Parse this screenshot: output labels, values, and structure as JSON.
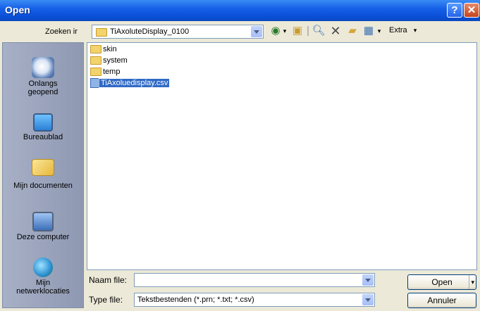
{
  "window": {
    "title": "Open"
  },
  "lookin": {
    "label": "Zoeken ir",
    "value": "TiAxoluteDisplay_0100"
  },
  "toolbar": {
    "extra_label": "Extra"
  },
  "places": [
    {
      "label": "Onlangs geopend"
    },
    {
      "label": "Bureaublad"
    },
    {
      "label": "Mijn documenten"
    },
    {
      "label": "Deze computer"
    },
    {
      "label": "Mijn netwerklocaties"
    }
  ],
  "files": [
    {
      "name": "skin",
      "type": "folder"
    },
    {
      "name": "system",
      "type": "folder"
    },
    {
      "name": "temp",
      "type": "folder"
    },
    {
      "name": "TiAxoluedisplay.csv",
      "type": "csv",
      "selected": true
    }
  ],
  "filename": {
    "label": "Naam file:",
    "value": ""
  },
  "filetype": {
    "label": "Type file:",
    "value": "Tekstbestenden (*.prn; *.txt; *.csv)"
  },
  "buttons": {
    "open": "Open",
    "cancel": "Annuler"
  }
}
